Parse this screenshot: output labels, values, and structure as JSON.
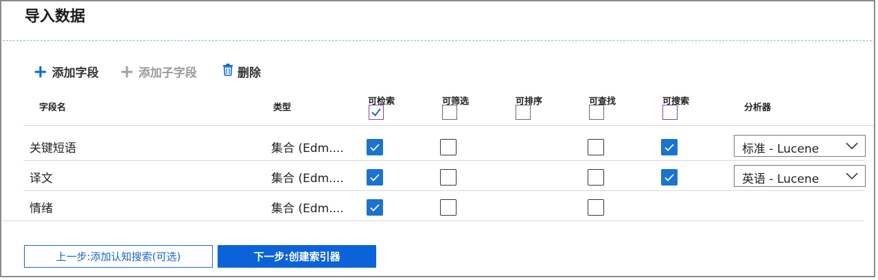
{
  "page": {
    "title": "导入数据"
  },
  "toolbar": {
    "add_field": "添加字段",
    "add_subfield": "添加子字段",
    "delete": "删除"
  },
  "table": {
    "headers": {
      "field_name": "字段名",
      "type": "类型",
      "retrievable": "可检索",
      "filterable": "可筛选",
      "sortable": "可排序",
      "facetable": "可查找",
      "searchable": "可搜索",
      "analyzer": "分析器"
    },
    "header_checkboxes": {
      "retrievable": true,
      "filterable": false,
      "sortable": false,
      "facetable": false,
      "searchable": false
    },
    "rows": [
      {
        "name": "关键短语",
        "type": "集合 (Edm....",
        "retrievable": true,
        "filterable": false,
        "facetable": false,
        "searchable": true,
        "analyzer": "标准 - Lucene"
      },
      {
        "name": "译文",
        "type": "集合 (Edm....",
        "retrievable": true,
        "filterable": false,
        "facetable": false,
        "searchable": true,
        "analyzer": "英语 - Lucene"
      },
      {
        "name": "情绪",
        "type": "集合 (Edm....",
        "retrievable": true,
        "filterable": false,
        "facetable": false
      }
    ]
  },
  "footer": {
    "prev_label": "上一步:添加认知搜索(可选)",
    "next_label": "下一步:创建索引器"
  },
  "colors": {
    "accent": "#0a63d8",
    "checkbox_on": "#1a73d1",
    "header_purple": "#7a3fb0"
  },
  "icons": {
    "add": "plus-icon",
    "delete": "trash-icon",
    "dropdown": "chevron-down-icon",
    "check": "check-icon"
  }
}
